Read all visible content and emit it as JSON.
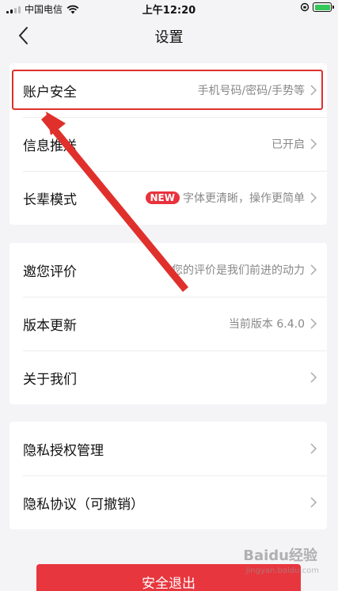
{
  "status_bar": {
    "carrier": "中国电信",
    "time": "上午12:20",
    "battery_level": 1.0,
    "battery_color": "#34c759"
  },
  "nav": {
    "back_icon": "chevron-left-icon",
    "title": "设置"
  },
  "group1": [
    {
      "label": "账户安全",
      "value": "手机号码/密码/手势等"
    },
    {
      "label": "信息推送",
      "value": "已开启"
    },
    {
      "label": "长辈模式",
      "badge": "NEW",
      "value": "字体更清晰，操作更简单"
    }
  ],
  "group2": [
    {
      "label": "邀您评价",
      "value": "您的评价是我们前进的动力"
    },
    {
      "label": "版本更新",
      "value": "当前版本 6.4.0"
    },
    {
      "label": "关于我们",
      "value": ""
    }
  ],
  "group3": [
    {
      "label": "隐私授权管理"
    },
    {
      "label": "隐私协议（可撤销）"
    }
  ],
  "logout_label": "安全退出",
  "annotation_color": "#e0302c",
  "accent_color": "#e8363e",
  "watermark": {
    "brand": "Baidu经验",
    "url": "jingyan.baidu.com"
  }
}
